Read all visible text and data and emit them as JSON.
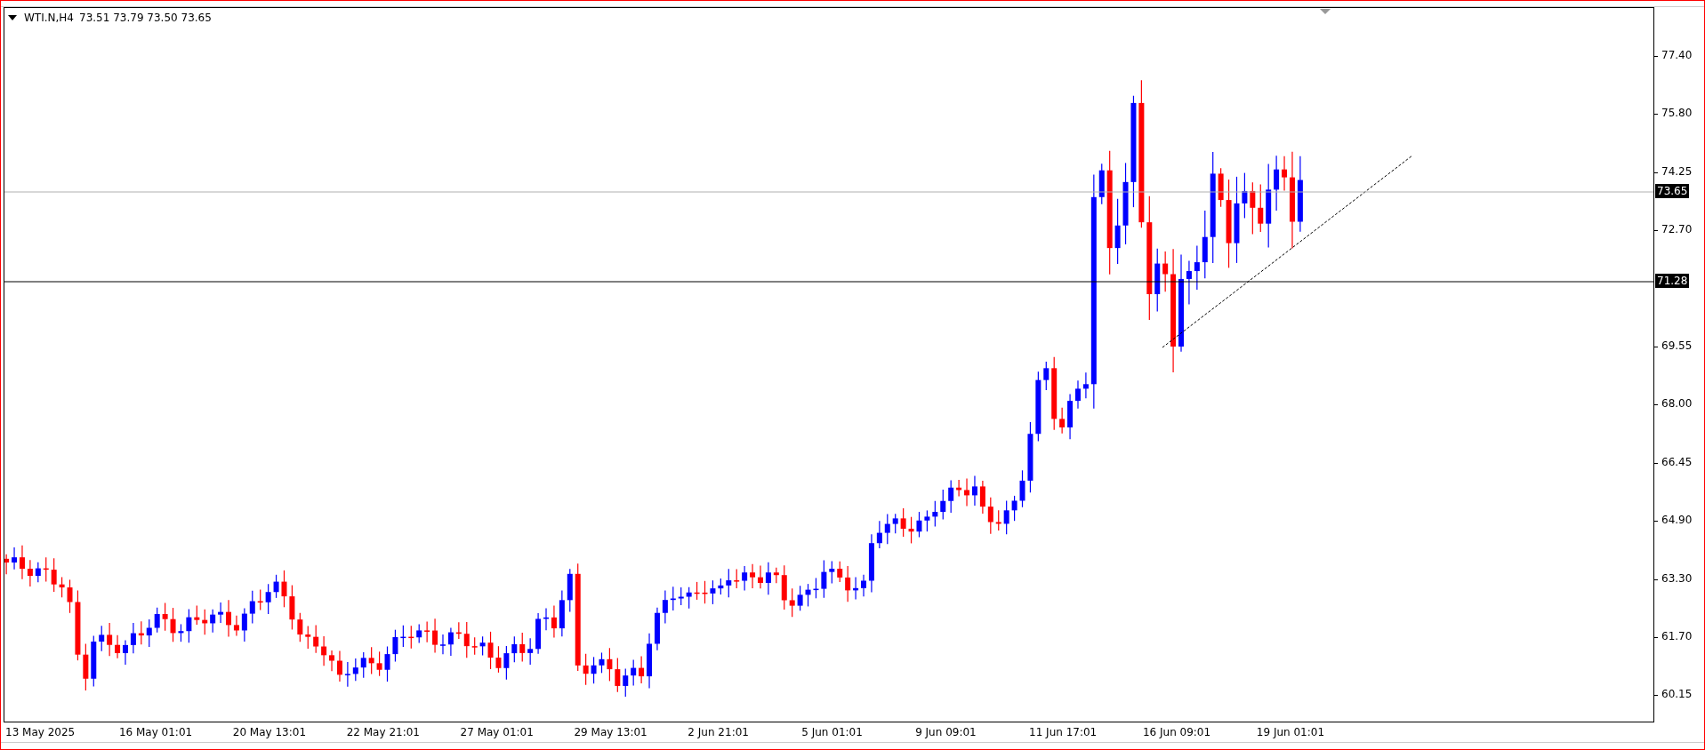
{
  "header": {
    "symbol": "WTI.N,H4",
    "ohlc": "73.51 73.79 73.50 73.65"
  },
  "y_axis": {
    "labels": [
      "77.40",
      "75.80",
      "74.25",
      "72.70",
      "69.55",
      "68.00",
      "66.45",
      "64.90",
      "63.30",
      "61.70",
      "60.15"
    ]
  },
  "price_markers": [
    {
      "label": "73.65",
      "kind": "bid"
    },
    {
      "label": "71.28",
      "kind": "level"
    }
  ],
  "x_axis": {
    "labels": [
      "13 May 2025",
      "16 May 01:01",
      "20 May 13:01",
      "22 May 21:01",
      "27 May 01:01",
      "29 May 13:01",
      "2 Jun 21:01",
      "5 Jun 01:01",
      "9 Jun 09:01",
      "11 Jun 17:01",
      "16 Jun 09:01",
      "19 Jun 01:01"
    ]
  }
}
